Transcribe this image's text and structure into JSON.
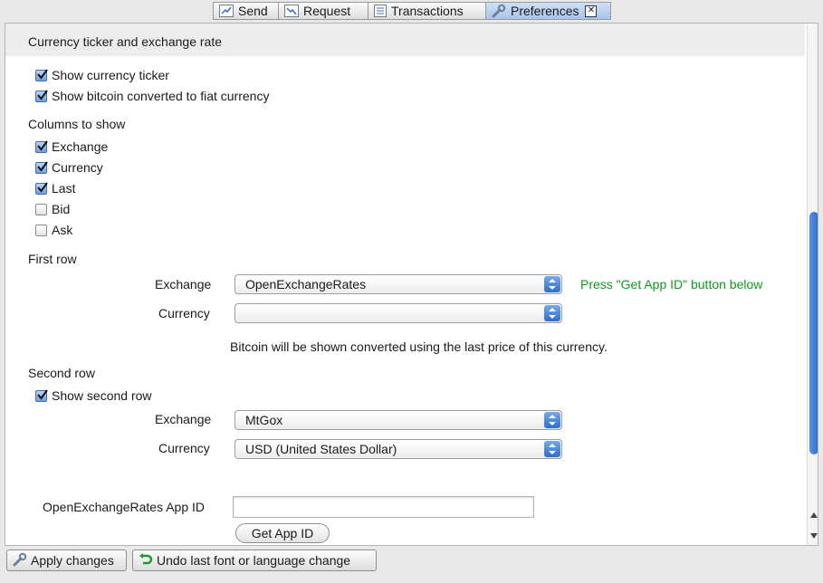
{
  "tabs": [
    {
      "label": "Send",
      "icon": "send-icon"
    },
    {
      "label": "Request",
      "icon": "request-icon"
    },
    {
      "label": "Transactions",
      "icon": "transactions-icon"
    },
    {
      "label": "Preferences",
      "icon": "wrench-icon",
      "selected": true,
      "close": "close-icon"
    }
  ],
  "section": {
    "title": "Currency ticker and exchange rate",
    "show_ticker": {
      "label": "Show currency ticker",
      "checked": true
    },
    "show_fiat": {
      "label": "Show bitcoin converted to fiat currency",
      "checked": true
    },
    "columns_title": "Columns to show",
    "columns": [
      {
        "label": "Exchange",
        "checked": true
      },
      {
        "label": "Currency",
        "checked": true
      },
      {
        "label": "Last",
        "checked": true
      },
      {
        "label": "Bid",
        "checked": false
      },
      {
        "label": "Ask",
        "checked": false
      }
    ],
    "first_row": {
      "title": "First row",
      "exchange_label": "Exchange",
      "exchange_value": "OpenExchangeRates",
      "hint": "Press \"Get App ID\" button below",
      "currency_label": "Currency",
      "currency_value": "",
      "note": "Bitcoin will be shown converted using the last price of this currency."
    },
    "second_row": {
      "title": "Second row",
      "show_second": {
        "label": "Show second row",
        "checked": true
      },
      "exchange_label": "Exchange",
      "exchange_value": "MtGox",
      "currency_label": "Currency",
      "currency_value": "USD (United States Dollar)"
    },
    "app_id": {
      "label": "OpenExchangeRates App ID",
      "value": "",
      "button": "Get App ID"
    }
  },
  "bottom": {
    "apply_label": "Apply changes",
    "undo_label": "Undo last font or language change"
  },
  "colors": {
    "accent": "#2c6ed4",
    "hint": "#0e9a1b",
    "tab_selected": "#a7c4ea"
  }
}
